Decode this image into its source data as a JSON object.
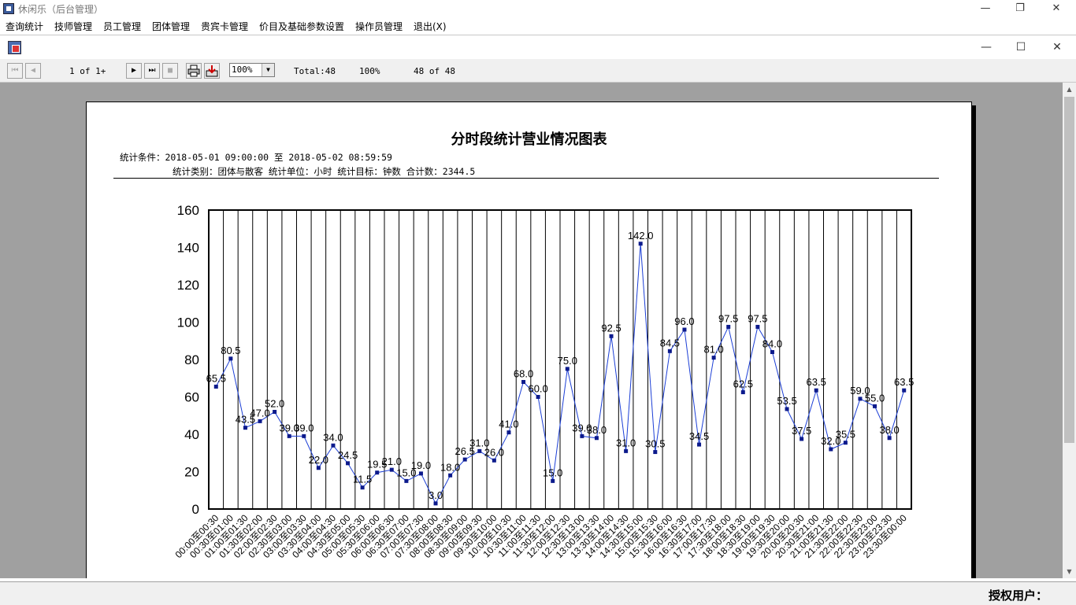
{
  "app": {
    "title": "休闲乐（后台管理）",
    "minimize_glyph": "—",
    "restore_glyph": "❐",
    "close_glyph": "✕"
  },
  "menu": [
    "查询统计",
    "技师管理",
    "员工管理",
    "团体管理",
    "贵宾卡管理",
    "价目及基础参数设置",
    "操作员管理",
    "退出(X)"
  ],
  "child_window": {
    "icon": "report-icon",
    "minimize_glyph": "—",
    "maximize_glyph": "☐",
    "close_glyph": "✕"
  },
  "toolbar": {
    "first_glyph": "⏮",
    "prev_glyph": "◀",
    "page_indicator": "1 of 1+",
    "next_glyph": "▶",
    "last_glyph": "⏭",
    "stop_glyph": "■",
    "print_icon": "printer-icon",
    "export_icon": "export-icon",
    "zoom_value": "100%",
    "zoom_arrow": "▼",
    "total": "Total:48",
    "percent": "100%",
    "records": "48 of 48"
  },
  "report": {
    "title": "分时段统计营业情况图表",
    "condition_line": "统计条件：2018-05-01 09:00:00 至 2018-05-02 08:59:59",
    "category_line": "统计类别：团体与散客   统计单位：小时   统计目标：钟数    合计数：2344.5"
  },
  "chart_data": {
    "type": "line",
    "title": "",
    "xlabel": "",
    "ylabel": "",
    "ylim": [
      0,
      160
    ],
    "y_ticks": [
      0,
      20,
      40,
      60,
      80,
      100,
      120,
      140,
      160
    ],
    "grid": "vertical",
    "line_color": "#1c3fd6",
    "marker_color": "#0c1a8c",
    "categories": [
      "00:00至00:30",
      "00:30至01:00",
      "01:00至01:30",
      "01:30至02:00",
      "02:00至02:30",
      "02:30至03:00",
      "03:00至03:30",
      "03:30至04:00",
      "04:00至04:30",
      "04:30至05:00",
      "05:00至05:30",
      "05:30至06:00",
      "06:00至06:30",
      "06:30至07:00",
      "07:00至07:30",
      "07:30至08:00",
      "08:00至08:30",
      "08:30至09:00",
      "09:00至09:30",
      "09:30至10:00",
      "10:00至10:30",
      "10:30至11:00",
      "11:00至11:30",
      "11:30至12:00",
      "12:00至12:30",
      "12:30至13:00",
      "13:00至13:30",
      "13:30至14:00",
      "14:00至14:30",
      "14:30至15:00",
      "15:00至15:30",
      "15:30至16:00",
      "16:00至16:30",
      "16:30至17:00",
      "17:00至17:30",
      "17:30至18:00",
      "18:00至18:30",
      "18:30至19:00",
      "19:00至19:30",
      "19:30至20:00",
      "20:00至20:30",
      "20:30至21:00",
      "21:00至21:30",
      "21:30至22:00",
      "22:00至22:30",
      "22:30至23:00",
      "23:00至23:30",
      "23:30至00:00"
    ],
    "values": [
      65.5,
      80.5,
      43.5,
      47.0,
      52.0,
      39.0,
      39.0,
      22.0,
      34.0,
      24.5,
      11.5,
      19.5,
      21.0,
      15.0,
      19.0,
      3.0,
      18.0,
      26.5,
      31.0,
      26.0,
      41.0,
      68.0,
      60.0,
      15.0,
      75.0,
      39.0,
      38.0,
      92.5,
      31.0,
      142.0,
      30.5,
      84.5,
      96.0,
      34.5,
      81.0,
      97.5,
      62.5,
      97.5,
      84.0,
      53.5,
      37.5,
      63.5,
      32.0,
      35.5,
      59.0,
      55.0,
      38.0,
      63.5
    ]
  },
  "status": {
    "user_label": "授权用户："
  },
  "scroll": {
    "up_glyph": "▲",
    "down_glyph": "▼"
  }
}
